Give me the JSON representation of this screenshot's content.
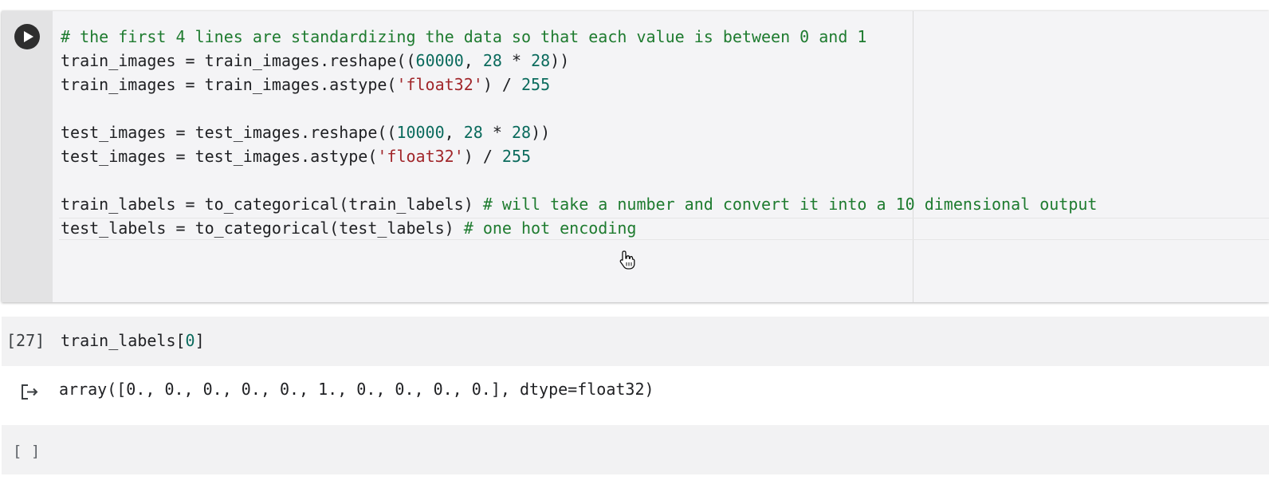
{
  "active_cell": {
    "run_button_icon": "play-icon",
    "lines": [
      [
        {
          "t": "comment",
          "v": "# the first 4 lines are standardizing the data so that each value is between 0 and 1"
        }
      ],
      [
        {
          "t": "plain",
          "v": "train_images = train_images.reshape(("
        },
        {
          "t": "number",
          "v": "60000"
        },
        {
          "t": "plain",
          "v": ", "
        },
        {
          "t": "number",
          "v": "28"
        },
        {
          "t": "plain",
          "v": " * "
        },
        {
          "t": "number",
          "v": "28"
        },
        {
          "t": "plain",
          "v": "))"
        }
      ],
      [
        {
          "t": "plain",
          "v": "train_images = train_images.astype("
        },
        {
          "t": "string",
          "v": "'float32'"
        },
        {
          "t": "plain",
          "v": ") / "
        },
        {
          "t": "number",
          "v": "255"
        }
      ],
      [],
      [
        {
          "t": "plain",
          "v": "test_images = test_images.reshape(("
        },
        {
          "t": "number",
          "v": "10000"
        },
        {
          "t": "plain",
          "v": ", "
        },
        {
          "t": "number",
          "v": "28"
        },
        {
          "t": "plain",
          "v": " * "
        },
        {
          "t": "number",
          "v": "28"
        },
        {
          "t": "plain",
          "v": "))"
        }
      ],
      [
        {
          "t": "plain",
          "v": "test_images = test_images.astype("
        },
        {
          "t": "string",
          "v": "'float32'"
        },
        {
          "t": "plain",
          "v": ") / "
        },
        {
          "t": "number",
          "v": "255"
        }
      ],
      [],
      [
        {
          "t": "plain",
          "v": "train_labels = to_categorical(train_labels) "
        },
        {
          "t": "comment",
          "v": "# will take a number and convert it into a 10 dimensional output"
        }
      ],
      [
        {
          "t": "plain",
          "v": "test_labels = to_categorical(test_labels) "
        },
        {
          "t": "comment",
          "v": "# one hot encoding"
        }
      ]
    ]
  },
  "cell_27": {
    "execution_count": "[27]",
    "code_prefix": "train_labels[",
    "code_index": "0",
    "code_suffix": "]"
  },
  "output": {
    "icon": "output-redirect-icon",
    "text": "array([0., 0., 0., 0., 0., 1., 0., 0., 0., 0.], dtype=float32)"
  },
  "empty_cell": {
    "execution_count": "[ ]"
  },
  "colors": {
    "comment": "#1e7b2f",
    "number": "#0b6b5d",
    "string": "#a1262a",
    "plain": "#202124"
  }
}
